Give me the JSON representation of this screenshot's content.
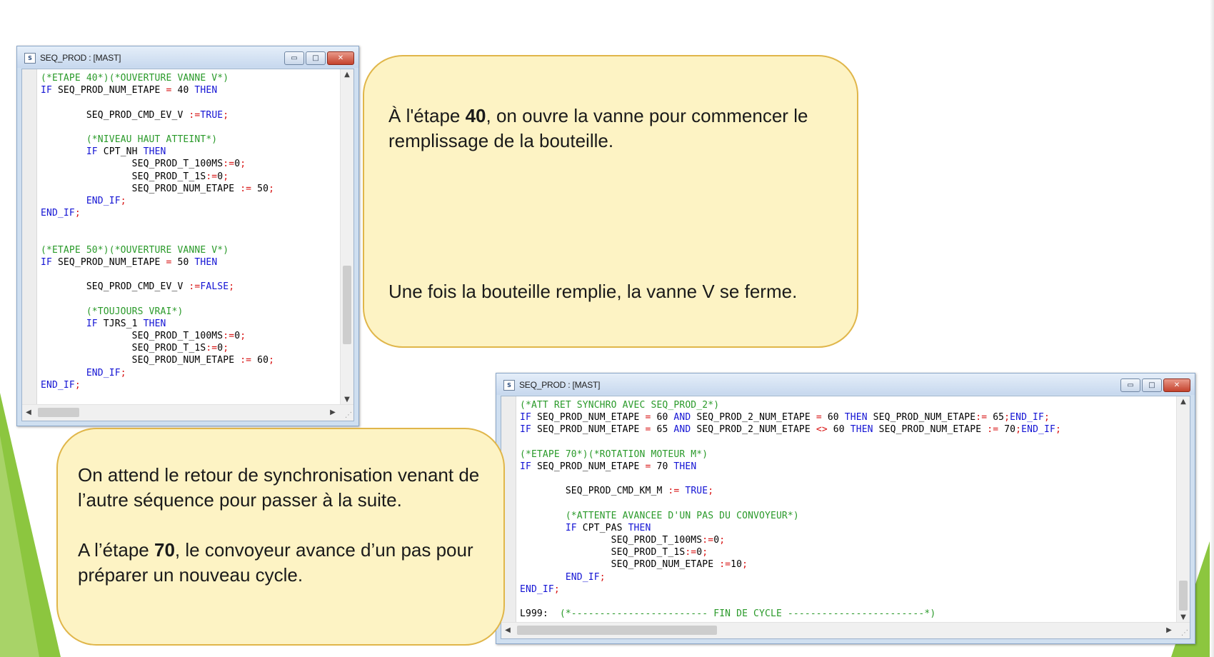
{
  "colors": {
    "comment": "#2a9a2a",
    "keyword": "#1414d4",
    "operator": "#d81414",
    "bubble_fill": "#fdf3c4",
    "bubble_border": "#e0b64a",
    "slide_green": "#8cc63f"
  },
  "window1": {
    "title": "SEQ_PROD : [MAST]",
    "icon": "st-editor-icon",
    "buttons": {
      "minimize": "▭",
      "maximize": "□",
      "close": "✕"
    },
    "code": [
      [
        [
          "cm",
          "(*ETAPE 40*)(*OUVERTURE VANNE V*)"
        ]
      ],
      [
        [
          "kw",
          "IF"
        ],
        [
          "tx",
          " SEQ_PROD_NUM_ETAPE "
        ],
        [
          "op",
          "="
        ],
        [
          "tx",
          " 40 "
        ],
        [
          "kw",
          "THEN"
        ]
      ],
      [],
      [
        [
          "tx",
          "        SEQ_PROD_CMD_EV_V "
        ],
        [
          "op",
          ":="
        ],
        [
          "kw",
          "TRUE"
        ],
        [
          "op",
          ";"
        ]
      ],
      [],
      [
        [
          "cm",
          "        (*NIVEAU HAUT ATTEINT*)"
        ]
      ],
      [
        [
          "kw",
          "        IF"
        ],
        [
          "tx",
          " CPT_NH "
        ],
        [
          "kw",
          "THEN"
        ]
      ],
      [
        [
          "tx",
          "                SEQ_PROD_T_100MS"
        ],
        [
          "op",
          ":="
        ],
        [
          "tx",
          "0"
        ],
        [
          "op",
          ";"
        ]
      ],
      [
        [
          "tx",
          "                SEQ_PROD_T_1S"
        ],
        [
          "op",
          ":="
        ],
        [
          "tx",
          "0"
        ],
        [
          "op",
          ";"
        ]
      ],
      [
        [
          "tx",
          "                SEQ_PROD_NUM_ETAPE "
        ],
        [
          "op",
          ":="
        ],
        [
          "tx",
          " 50"
        ],
        [
          "op",
          ";"
        ]
      ],
      [
        [
          "kw",
          "        END_IF"
        ],
        [
          "op",
          ";"
        ]
      ],
      [
        [
          "kw",
          "END_IF"
        ],
        [
          "op",
          ";"
        ]
      ],
      [],
      [],
      [
        [
          "cm",
          "(*ETAPE 50*)(*OUVERTURE VANNE V*)"
        ]
      ],
      [
        [
          "kw",
          "IF"
        ],
        [
          "tx",
          " SEQ_PROD_NUM_ETAPE "
        ],
        [
          "op",
          "="
        ],
        [
          "tx",
          " 50 "
        ],
        [
          "kw",
          "THEN"
        ]
      ],
      [],
      [
        [
          "tx",
          "        SEQ_PROD_CMD_EV_V "
        ],
        [
          "op",
          ":="
        ],
        [
          "kw",
          "FALSE"
        ],
        [
          "op",
          ";"
        ]
      ],
      [],
      [
        [
          "cm",
          "        (*TOUJOURS VRAI*)"
        ]
      ],
      [
        [
          "kw",
          "        IF"
        ],
        [
          "tx",
          " TJRS_1 "
        ],
        [
          "kw",
          "THEN"
        ]
      ],
      [
        [
          "tx",
          "                SEQ_PROD_T_100MS"
        ],
        [
          "op",
          ":="
        ],
        [
          "tx",
          "0"
        ],
        [
          "op",
          ";"
        ]
      ],
      [
        [
          "tx",
          "                SEQ_PROD_T_1S"
        ],
        [
          "op",
          ":="
        ],
        [
          "tx",
          "0"
        ],
        [
          "op",
          ";"
        ]
      ],
      [
        [
          "tx",
          "                SEQ_PROD_NUM_ETAPE "
        ],
        [
          "op",
          ":="
        ],
        [
          "tx",
          " 60"
        ],
        [
          "op",
          ";"
        ]
      ],
      [
        [
          "kw",
          "        END_IF"
        ],
        [
          "op",
          ";"
        ]
      ],
      [
        [
          "kw",
          "END_IF"
        ],
        [
          "op",
          ";"
        ]
      ]
    ]
  },
  "window2": {
    "title": "SEQ_PROD : [MAST]",
    "icon": "st-editor-icon",
    "buttons": {
      "minimize": "▭",
      "maximize": "□",
      "close": "✕"
    },
    "code": [
      [
        [
          "cm",
          "(*ATT RET SYNCHRO AVEC SEQ_PROD_2*)"
        ]
      ],
      [
        [
          "kw",
          "IF"
        ],
        [
          "tx",
          " SEQ_PROD_NUM_ETAPE "
        ],
        [
          "op",
          "="
        ],
        [
          "tx",
          " 60 "
        ],
        [
          "kw",
          "AND"
        ],
        [
          "tx",
          " SEQ_PROD_2_NUM_ETAPE "
        ],
        [
          "op",
          "="
        ],
        [
          "tx",
          " 60 "
        ],
        [
          "kw",
          "THEN"
        ],
        [
          "tx",
          " SEQ_PROD_NUM_ETAPE"
        ],
        [
          "op",
          ":="
        ],
        [
          "tx",
          " 65"
        ],
        [
          "op",
          ";"
        ],
        [
          "kw",
          "END_IF"
        ],
        [
          "op",
          ";"
        ]
      ],
      [
        [
          "kw",
          "IF"
        ],
        [
          "tx",
          " SEQ_PROD_NUM_ETAPE "
        ],
        [
          "op",
          "="
        ],
        [
          "tx",
          " 65 "
        ],
        [
          "kw",
          "AND"
        ],
        [
          "tx",
          " SEQ_PROD_2_NUM_ETAPE "
        ],
        [
          "op",
          "<>"
        ],
        [
          "tx",
          " 60 "
        ],
        [
          "kw",
          "THEN"
        ],
        [
          "tx",
          " SEQ_PROD_NUM_ETAPE "
        ],
        [
          "op",
          ":="
        ],
        [
          "tx",
          " 70"
        ],
        [
          "op",
          ";"
        ],
        [
          "kw",
          "END_IF"
        ],
        [
          "op",
          ";"
        ]
      ],
      [],
      [
        [
          "cm",
          "(*ETAPE 70*)(*ROTATION MOTEUR M*)"
        ]
      ],
      [
        [
          "kw",
          "IF"
        ],
        [
          "tx",
          " SEQ_PROD_NUM_ETAPE "
        ],
        [
          "op",
          "="
        ],
        [
          "tx",
          " 70 "
        ],
        [
          "kw",
          "THEN"
        ]
      ],
      [],
      [
        [
          "tx",
          "        SEQ_PROD_CMD_KM_M "
        ],
        [
          "op",
          ":="
        ],
        [
          "kw",
          " TRUE"
        ],
        [
          "op",
          ";"
        ]
      ],
      [],
      [
        [
          "cm",
          "        (*ATTENTE AVANCEE D'UN PAS DU CONVOYEUR*)"
        ]
      ],
      [
        [
          "kw",
          "        IF"
        ],
        [
          "tx",
          " CPT_PAS "
        ],
        [
          "kw",
          "THEN"
        ]
      ],
      [
        [
          "tx",
          "                SEQ_PROD_T_100MS"
        ],
        [
          "op",
          ":="
        ],
        [
          "tx",
          "0"
        ],
        [
          "op",
          ";"
        ]
      ],
      [
        [
          "tx",
          "                SEQ_PROD_T_1S"
        ],
        [
          "op",
          ":="
        ],
        [
          "tx",
          "0"
        ],
        [
          "op",
          ";"
        ]
      ],
      [
        [
          "tx",
          "                SEQ_PROD_NUM_ETAPE "
        ],
        [
          "op",
          ":="
        ],
        [
          "tx",
          "10"
        ],
        [
          "op",
          ";"
        ]
      ],
      [
        [
          "kw",
          "        END_IF"
        ],
        [
          "op",
          ";"
        ]
      ],
      [
        [
          "kw",
          "END_IF"
        ],
        [
          "op",
          ";"
        ]
      ],
      [],
      [
        [
          "tx",
          "L999:  "
        ],
        [
          "cm",
          "(*------------------------ FIN DE CYCLE ------------------------*)"
        ]
      ]
    ]
  },
  "callout_top": {
    "p1_before": "À l'étape ",
    "p1_bold": "40",
    "p1_after": ", on ouvre la vanne pour commencer le remplissage de la bouteille.",
    "p2": "Une fois la bouteille remplie, la vanne V se ferme."
  },
  "callout_bottom": {
    "p1": "On  attend le retour de synchronisation venant de l’autre séquence pour passer à la suite.",
    "p2_before": "A l’étape ",
    "p2_bold": "70",
    "p2_after": ", le convoyeur avance d’un pas pour préparer un nouveau cycle."
  }
}
